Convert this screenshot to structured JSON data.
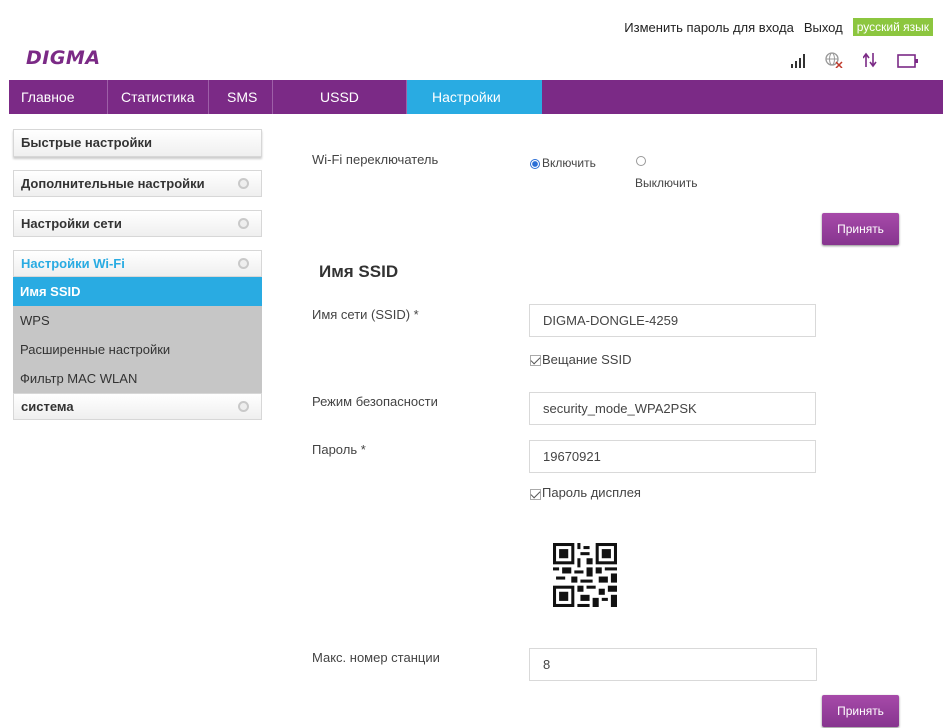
{
  "header": {
    "logo": "DIGMA",
    "change_password": "Изменить пароль для входа",
    "logout": "Выход",
    "language": "русский язык",
    "icons": [
      "signal-icon",
      "globe-icon",
      "data-transfer-icon",
      "battery-icon"
    ]
  },
  "nav": {
    "tabs": [
      {
        "label": "Главное"
      },
      {
        "label": "Статистика"
      },
      {
        "label": "SMS"
      },
      {
        "label": "USSD"
      },
      {
        "label": "Настройки",
        "active": true
      }
    ]
  },
  "sidebar": {
    "quick": "Быстрые настройки",
    "advanced": "Дополнительные настройки",
    "network": "Настройки сети",
    "wifi": "Настройки Wi-Fi",
    "wifi_items": [
      {
        "label": "Имя SSID",
        "active": true
      },
      {
        "label": "WPS"
      },
      {
        "label": "Расширенные настройки"
      },
      {
        "label": "Фильтр MAC WLAN"
      }
    ],
    "system": "система"
  },
  "content": {
    "wifi_switch_label": "Wi-Fi переключатель",
    "on_label": "Включить",
    "off_label": "Выключить",
    "apply_label": "Принять",
    "section_title": "Имя SSID",
    "ssid_label": "Имя сети (SSID) *",
    "ssid_value": "DIGMA-DONGLE-4259",
    "broadcast_label": "Вещание SSID",
    "security_label": "Режим безопасности",
    "security_value": "security_mode_WPA2PSK",
    "password_label": "Пароль *",
    "password_value": "19670921",
    "show_password_label": "Пароль дисплея",
    "max_station_label": "Макс. номер станции",
    "max_station_value": "8"
  },
  "colors": {
    "brand": "#7b2a86",
    "accent": "#29abe2",
    "language_bg": "#8cc63f"
  }
}
